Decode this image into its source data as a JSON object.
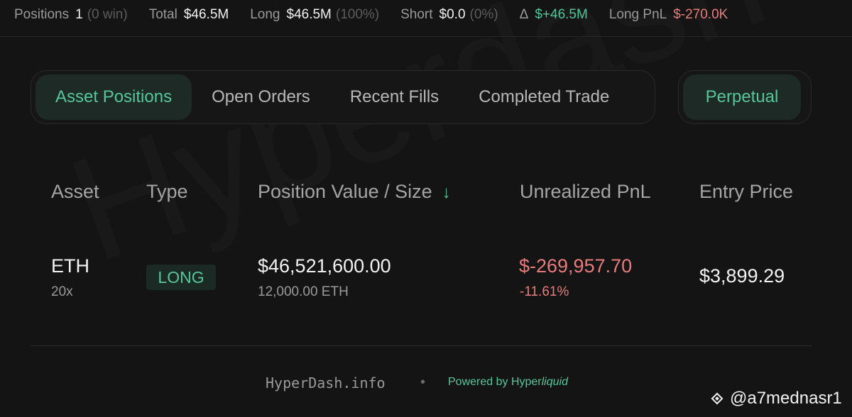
{
  "stats": {
    "positions_label": "Positions",
    "positions_value": "1",
    "positions_sub": "(0 win)",
    "total_label": "Total",
    "total_value": "$46.5M",
    "long_label": "Long",
    "long_value": "$46.5M",
    "long_sub": "(100%)",
    "short_label": "Short",
    "short_value": "$0.0",
    "short_sub": "(0%)",
    "delta_label": "Δ",
    "delta_value": "$+46.5M",
    "longpnl_label": "Long PnL",
    "longpnl_value": "$-270.0K"
  },
  "tabs": [
    {
      "label": "Asset Positions",
      "active": true
    },
    {
      "label": "Open Orders",
      "active": false
    },
    {
      "label": "Recent Fills",
      "active": false
    },
    {
      "label": "Completed Trade",
      "active": false
    }
  ],
  "market_toggle": {
    "label": "Perpetual"
  },
  "table": {
    "headers": [
      "Asset",
      "Type",
      "Position Value / Size",
      "Unrealized PnL",
      "Entry Price"
    ],
    "rows": [
      {
        "asset": "ETH",
        "leverage": "20x",
        "type": "LONG",
        "position_value": "$46,521,600.00",
        "size": "12,000.00 ETH",
        "unrealized_pnl": "$-269,957.70",
        "pnl_percent": "-11.61%",
        "entry_price": "$3,899.29"
      }
    ]
  },
  "footer": {
    "site": "HyperDash.info",
    "separator": "•",
    "powered_prefix": "Powered by Hyper",
    "powered_suffix": "liquid"
  },
  "watermark": {
    "text": "Hyperdash",
    "handle": "@a7mednasr1"
  },
  "colors": {
    "accent_green": "#56c79c",
    "negative_red": "#e87c7c",
    "background": "#141414"
  },
  "icons": {
    "sort": "arrow-down-icon",
    "handle_logo": "binance-diamond-icon"
  }
}
